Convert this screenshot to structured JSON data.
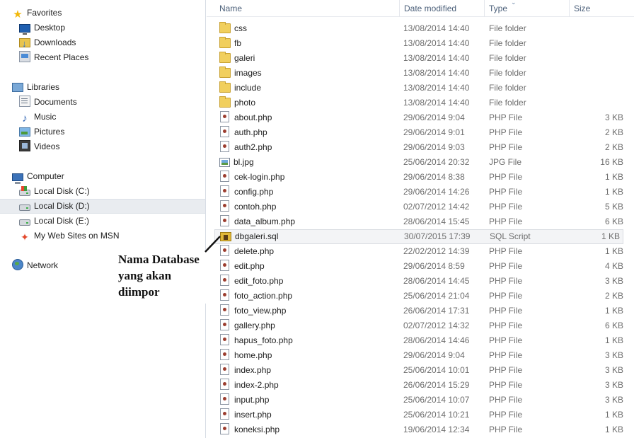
{
  "navigation": {
    "favorites": {
      "label": "Favorites",
      "icon": "star-icon",
      "items": [
        {
          "label": "Desktop",
          "icon": "desktop-icon"
        },
        {
          "label": "Downloads",
          "icon": "downloads-folder-icon"
        },
        {
          "label": "Recent Places",
          "icon": "recent-places-icon"
        }
      ]
    },
    "libraries": {
      "label": "Libraries",
      "icon": "libraries-icon",
      "items": [
        {
          "label": "Documents",
          "icon": "documents-icon"
        },
        {
          "label": "Music",
          "icon": "music-icon"
        },
        {
          "label": "Pictures",
          "icon": "pictures-icon"
        },
        {
          "label": "Videos",
          "icon": "videos-icon"
        }
      ]
    },
    "computer": {
      "label": "Computer",
      "icon": "computer-icon",
      "items": [
        {
          "label": "Local Disk (C:)",
          "icon": "system-disk-icon"
        },
        {
          "label": "Local Disk (D:)",
          "icon": "disk-icon",
          "selected": true
        },
        {
          "label": "Local Disk (E:)",
          "icon": "disk-icon"
        },
        {
          "label": "My Web Sites on MSN",
          "icon": "msn-icon"
        }
      ]
    },
    "network": {
      "label": "Network",
      "icon": "network-icon"
    }
  },
  "columns": {
    "name": "Name",
    "date": "Date modified",
    "type": "Type",
    "size": "Size"
  },
  "files": [
    {
      "name": "css",
      "date": "13/08/2014 14:40",
      "type": "File folder",
      "size": "",
      "icon": "folder"
    },
    {
      "name": "fb",
      "date": "13/08/2014 14:40",
      "type": "File folder",
      "size": "",
      "icon": "folder"
    },
    {
      "name": "galeri",
      "date": "13/08/2014 14:40",
      "type": "File folder",
      "size": "",
      "icon": "folder"
    },
    {
      "name": "images",
      "date": "13/08/2014 14:40",
      "type": "File folder",
      "size": "",
      "icon": "folder"
    },
    {
      "name": "include",
      "date": "13/08/2014 14:40",
      "type": "File folder",
      "size": "",
      "icon": "folder"
    },
    {
      "name": "photo",
      "date": "13/08/2014 14:40",
      "type": "File folder",
      "size": "",
      "icon": "folder"
    },
    {
      "name": "about.php",
      "date": "29/06/2014 9:04",
      "type": "PHP File",
      "size": "3 KB",
      "icon": "php"
    },
    {
      "name": "auth.php",
      "date": "29/06/2014 9:01",
      "type": "PHP File",
      "size": "2 KB",
      "icon": "php"
    },
    {
      "name": "auth2.php",
      "date": "29/06/2014 9:03",
      "type": "PHP File",
      "size": "2 KB",
      "icon": "php"
    },
    {
      "name": "bl.jpg",
      "date": "25/06/2014 20:32",
      "type": "JPG File",
      "size": "16 KB",
      "icon": "jpg"
    },
    {
      "name": "cek-login.php",
      "date": "29/06/2014 8:38",
      "type": "PHP File",
      "size": "1 KB",
      "icon": "php"
    },
    {
      "name": "config.php",
      "date": "29/06/2014 14:26",
      "type": "PHP File",
      "size": "1 KB",
      "icon": "php"
    },
    {
      "name": "contoh.php",
      "date": "02/07/2012 14:42",
      "type": "PHP File",
      "size": "5 KB",
      "icon": "php"
    },
    {
      "name": "data_album.php",
      "date": "28/06/2014 15:45",
      "type": "PHP File",
      "size": "6 KB",
      "icon": "php"
    },
    {
      "name": "dbgaleri.sql",
      "date": "30/07/2015 17:39",
      "type": "SQL Script",
      "size": "1 KB",
      "icon": "sql",
      "selected": true
    },
    {
      "name": "delete.php",
      "date": "22/02/2012 14:39",
      "type": "PHP File",
      "size": "1 KB",
      "icon": "php"
    },
    {
      "name": "edit.php",
      "date": "29/06/2014 8:59",
      "type": "PHP File",
      "size": "4 KB",
      "icon": "php"
    },
    {
      "name": "edit_foto.php",
      "date": "28/06/2014 14:45",
      "type": "PHP File",
      "size": "3 KB",
      "icon": "php"
    },
    {
      "name": "foto_action.php",
      "date": "25/06/2014 21:04",
      "type": "PHP File",
      "size": "2 KB",
      "icon": "php"
    },
    {
      "name": "foto_view.php",
      "date": "26/06/2014 17:31",
      "type": "PHP File",
      "size": "1 KB",
      "icon": "php"
    },
    {
      "name": "gallery.php",
      "date": "02/07/2012 14:32",
      "type": "PHP File",
      "size": "6 KB",
      "icon": "php"
    },
    {
      "name": "hapus_foto.php",
      "date": "28/06/2014 14:46",
      "type": "PHP File",
      "size": "1 KB",
      "icon": "php"
    },
    {
      "name": "home.php",
      "date": "29/06/2014 9:04",
      "type": "PHP File",
      "size": "3 KB",
      "icon": "php"
    },
    {
      "name": "index.php",
      "date": "25/06/2014 10:01",
      "type": "PHP File",
      "size": "3 KB",
      "icon": "php"
    },
    {
      "name": "index-2.php",
      "date": "26/06/2014 15:29",
      "type": "PHP File",
      "size": "3 KB",
      "icon": "php"
    },
    {
      "name": "input.php",
      "date": "25/06/2014 10:07",
      "type": "PHP File",
      "size": "3 KB",
      "icon": "php"
    },
    {
      "name": "insert.php",
      "date": "25/06/2014 10:21",
      "type": "PHP File",
      "size": "1 KB",
      "icon": "php"
    },
    {
      "name": "koneksi.php",
      "date": "19/06/2014 12:34",
      "type": "PHP File",
      "size": "1 KB",
      "icon": "php"
    }
  ],
  "annotation": {
    "lines": [
      "Nama Database",
      "yang akan",
      "diimpor"
    ],
    "points_to": "dbgaleri.sql"
  },
  "colors": {
    "selection_background": "#f3f4f6",
    "nav_selection_background": "#e9ecf0",
    "header_text": "#4c607a",
    "secondary_text": "#6d6d6d"
  }
}
